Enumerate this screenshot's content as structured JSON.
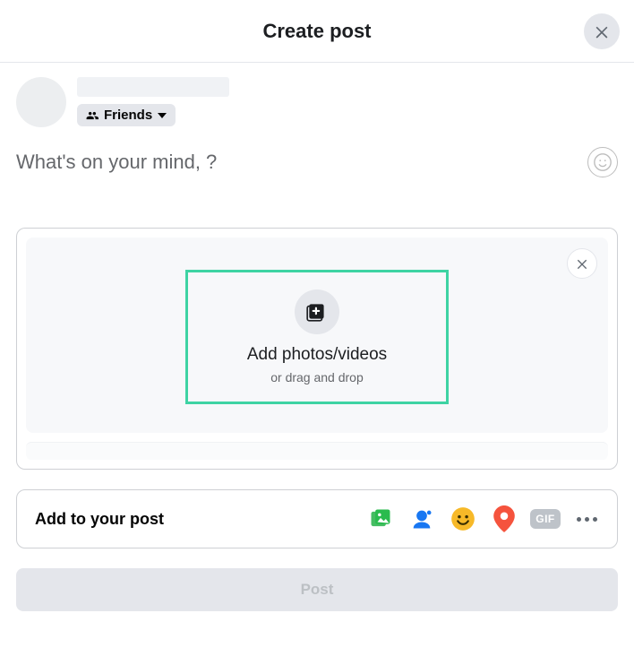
{
  "header": {
    "title": "Create post"
  },
  "audience": {
    "label": "Friends"
  },
  "compose": {
    "placeholder": "What's on your mind,               ?"
  },
  "media": {
    "title": "Add photos/videos",
    "subtitle": "or drag and drop"
  },
  "addto": {
    "label": "Add to your post",
    "gif": "GIF"
  },
  "post": {
    "label": "Post"
  }
}
